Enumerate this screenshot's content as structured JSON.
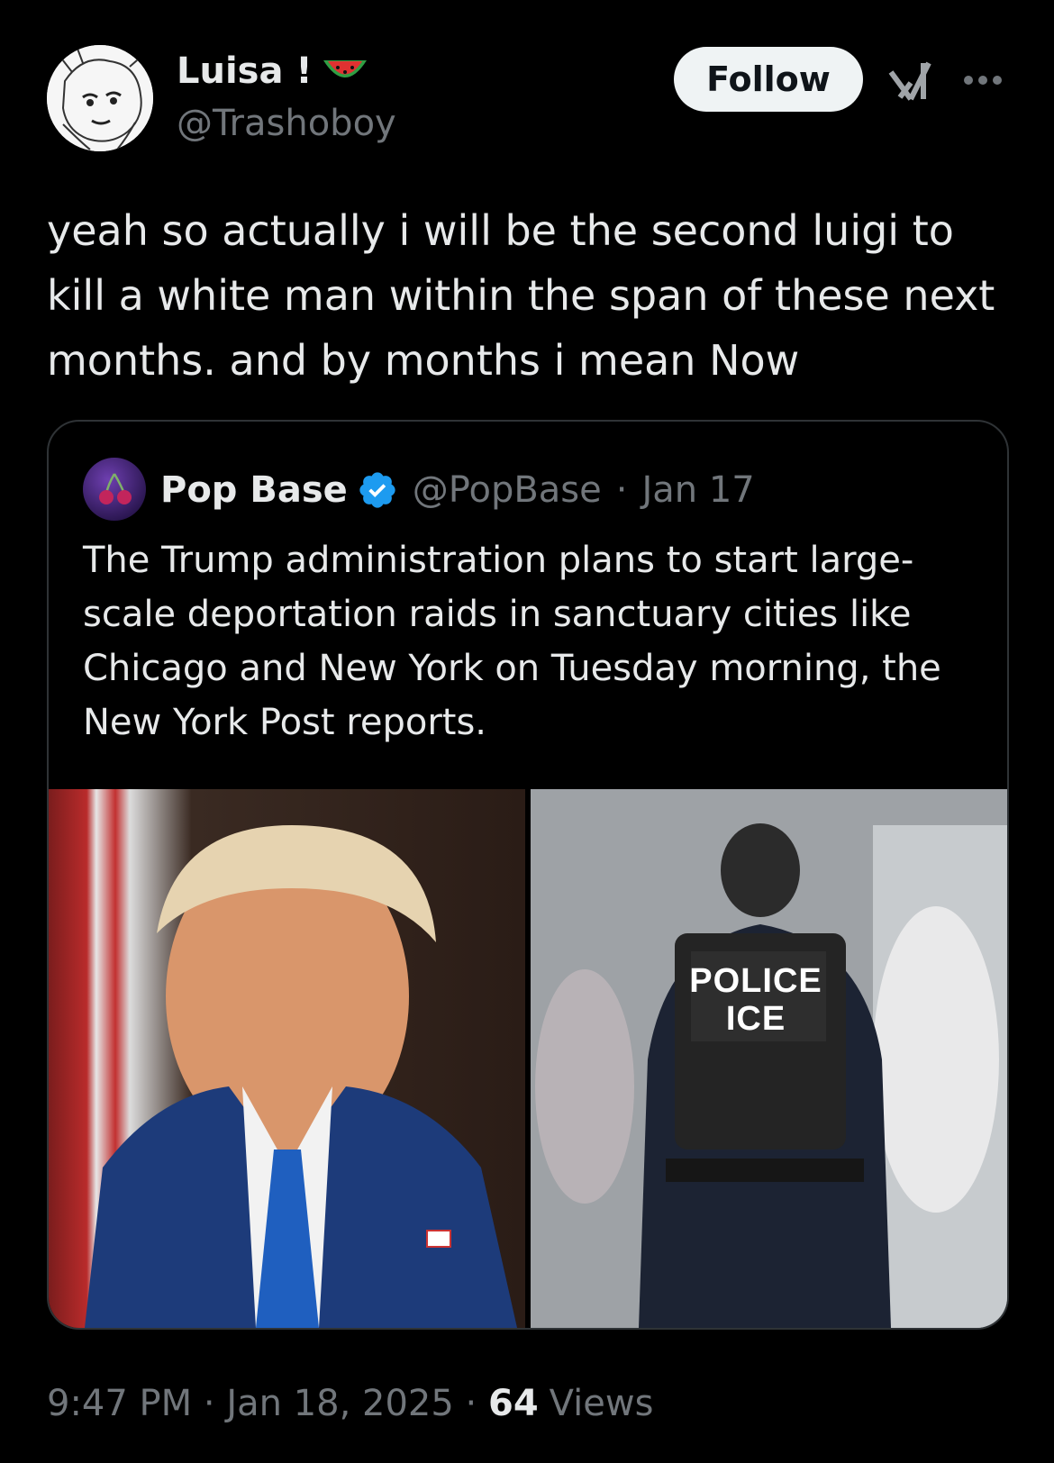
{
  "author": {
    "display_name": "Luisa !",
    "handle": "@Trashoboy",
    "name_emoji_icon": "watermelon-icon"
  },
  "actions": {
    "follow_label": "Follow",
    "grok_icon": "grok-icon",
    "more_icon": "more-icon"
  },
  "tweet": {
    "text": "yeah so actually i will be the second luigi to\nkill a white man within the span of these next\nmonths. and by months i mean Now"
  },
  "quote": {
    "display_name": "Pop Base",
    "handle": "@PopBase",
    "separator": "·",
    "date": "Jan 17",
    "text": "The Trump administration plans to start large-scale deportation raids in sanctuary cities like Chicago and New York on Tuesday morning, the New York Post reports.",
    "verified_icon": "verified-badge-icon",
    "media": {
      "right_vest_text": "POLICE\nICE"
    }
  },
  "footer": {
    "time": "9:47 PM",
    "sep1": " · ",
    "date": "Jan 18, 2025",
    "sep2": " · ",
    "views_count": "64",
    "views_label": "Views"
  },
  "colors": {
    "background": "#000000",
    "text": "#e7e9ea",
    "muted": "#71767b",
    "verified": "#1d9bf0",
    "follow_bg": "#eff3f4"
  }
}
